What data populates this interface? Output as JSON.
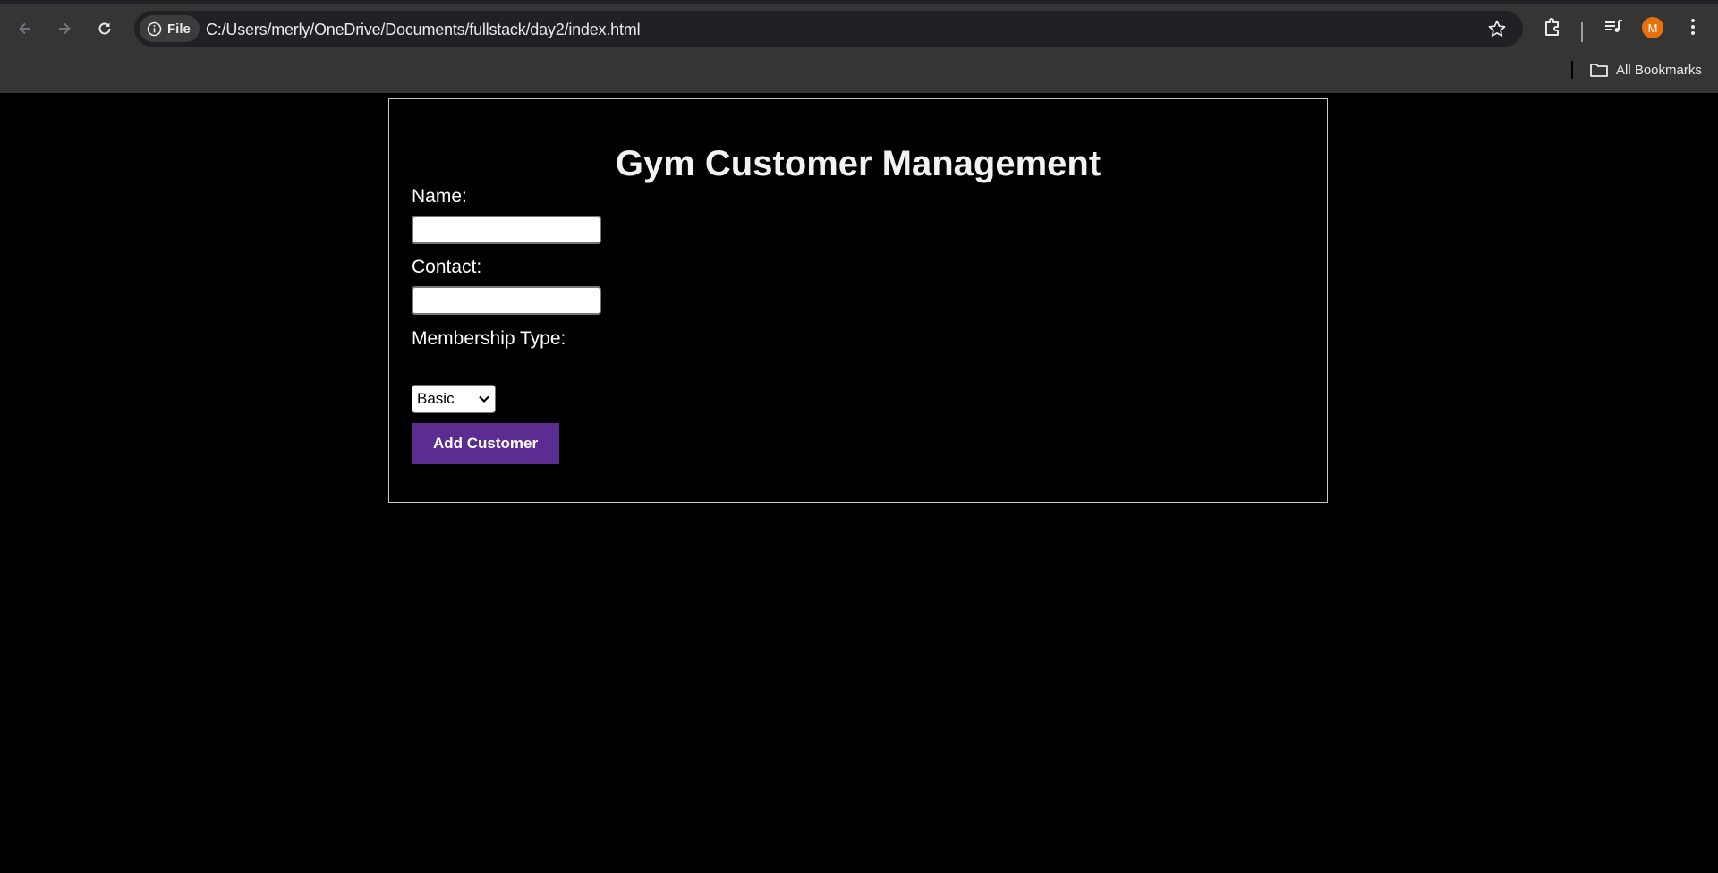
{
  "browser": {
    "site_chip_label": "File",
    "url": "C:/Users/merly/OneDrive/Documents/fullstack/day2/index.html",
    "profile_initial": "M",
    "bookmarks_label": "All Bookmarks"
  },
  "form": {
    "title": "Gym Customer Management",
    "name_label": "Name:",
    "name_value": "",
    "contact_label": "Contact:",
    "contact_value": "",
    "membership_label": "Membership Type:",
    "membership_selected": "Basic",
    "submit_label": "Add Customer"
  },
  "colors": {
    "page_background": "#000000",
    "button_background": "#5c2d91",
    "avatar": "#e8710a"
  }
}
